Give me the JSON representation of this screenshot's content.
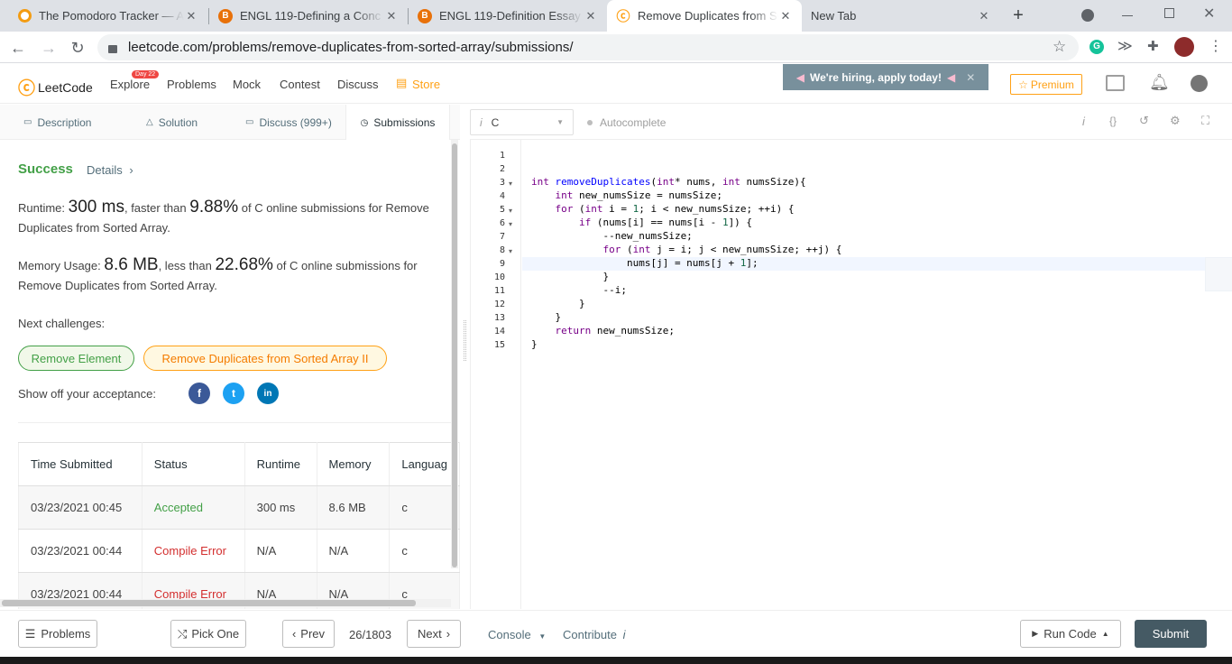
{
  "browser": {
    "tabs": [
      {
        "title": "The Pomodoro Tracker — A",
        "favicon_color": "#f39c12"
      },
      {
        "title": "ENGL 119-Defining a Conc",
        "favicon_color": "#e8710a"
      },
      {
        "title": "ENGL 119-Definition Essay",
        "favicon_color": "#e8710a"
      },
      {
        "title": "Remove Duplicates from So",
        "favicon_color": "#ffa116"
      },
      {
        "title": "New Tab",
        "favicon_color": ""
      }
    ],
    "new_tab_symbol": "+",
    "url": "leetcode.com/problems/remove-duplicates-from-sorted-array/submissions/"
  },
  "nav": {
    "brand": "LeetCode",
    "explore": "Explore",
    "day_badge": "Day 22",
    "problems": "Problems",
    "mock": "Mock",
    "contest": "Contest",
    "discuss": "Discuss",
    "store": "Store",
    "hiring_banner": "We're hiring, apply today!",
    "premium": "Premium"
  },
  "left_tabs": {
    "description": "Description",
    "solution": "Solution",
    "discuss": "Discuss (999+)",
    "submissions": "Submissions"
  },
  "result": {
    "status": "Success",
    "details": "Details",
    "runtime_label": "Runtime:",
    "runtime_value": "300 ms",
    "runtime_mid": ", faster than",
    "runtime_pct": "9.88%",
    "runtime_tail": "of C online submissions for Remove Duplicates from Sorted Array.",
    "memory_label": "Memory Usage:",
    "memory_value": "8.6 MB",
    "memory_mid": ", less than",
    "memory_pct": "22.68%",
    "memory_tail": "of C online submissions for Remove Duplicates from Sorted Array.",
    "next_label": "Next challenges:",
    "challenge1": "Remove Element",
    "challenge2": "Remove Duplicates from Sorted Array II",
    "show_off": "Show off your acceptance:"
  },
  "table": {
    "headers": [
      "Time Submitted",
      "Status",
      "Runtime",
      "Memory",
      "Languag"
    ],
    "rows": [
      {
        "time": "03/23/2021 00:45",
        "status": "Accepted",
        "runtime": "300 ms",
        "memory": "8.6 MB",
        "lang": "c"
      },
      {
        "time": "03/23/2021 00:44",
        "status": "Compile Error",
        "runtime": "N/A",
        "memory": "N/A",
        "lang": "c"
      },
      {
        "time": "03/23/2021 00:44",
        "status": "Compile Error",
        "runtime": "N/A",
        "memory": "N/A",
        "lang": "c"
      }
    ]
  },
  "editor": {
    "language": "C",
    "autocomplete": "Autocomplete",
    "code_lines": [
      "",
      "",
      "int removeDuplicates(int* nums, int numsSize){",
      "    int new_numsSize = numsSize;",
      "    for (int i = 1; i < new_numsSize; ++i) {",
      "        if (nums[i] == nums[i - 1]) {",
      "            --new_numsSize;",
      "            for (int j = i; j < new_numsSize; ++j) {",
      "                nums[j] = nums[j + 1];",
      "            }",
      "            --i;",
      "        }",
      "    }",
      "    return new_numsSize;",
      "}"
    ]
  },
  "footer": {
    "problems": "Problems",
    "pick_one": "Pick One",
    "prev": "Prev",
    "counter": "26/1803",
    "next": "Next",
    "console": "Console",
    "contribute": "Contribute",
    "run_code": "Run Code",
    "submit": "Submit"
  },
  "colors": {
    "success": "#43a047",
    "brand_orange": "#ffa116",
    "error": "#d32f2f",
    "submit_bg": "#455a64"
  }
}
